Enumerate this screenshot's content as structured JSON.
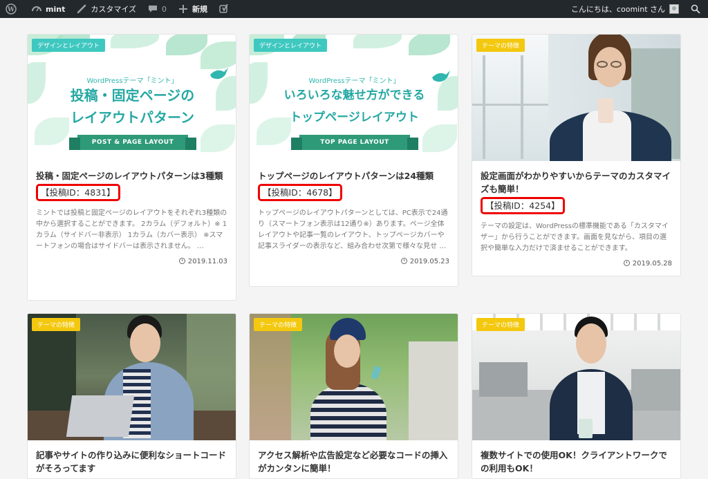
{
  "adminbar": {
    "site_name": "mint",
    "customize": "カスタマイズ",
    "comments_count": "0",
    "new_label": "新規",
    "greeting": "こんにちは、coomint さん"
  },
  "cards": [
    {
      "category": "デザインとレイアウト",
      "thumb_line1": "WordPressテーマ「ミント」",
      "thumb_line2": "投稿・固定ページの",
      "thumb_line3": "レイアウトパターン",
      "ribbon": "POST & PAGE LAYOUT",
      "title": "投稿・固定ページのレイアウトパターンは3種類",
      "post_id": "【投稿ID：4831】",
      "excerpt": "ミントでは投稿と固定ページのレイアウトをそれぞれ3種類の中から選択することができます。 2カラム（デフォルト）※ 1カラム（サイドバー非表示） 1カラム（カバー表示） ※スマートフォンの場合はサイドバーは表示されません。 …",
      "date": "2019.11.03"
    },
    {
      "category": "デザインとレイアウト",
      "thumb_line1": "WordPressテーマ「ミント」",
      "thumb_line2": "いろいろな魅せ方ができる",
      "thumb_line3": "トップページレイアウト",
      "ribbon": "TOP PAGE LAYOUT",
      "title": "トップページのレイアウトパターンは24種類",
      "post_id": "【投稿ID：4678】",
      "excerpt": "トップページのレイアウトパターンとしては、PC表示で24通り（スマートフォン表示は12通り※）あります。ページ全体レイアウトや記事一覧のレイアウト、トップページカバーや記事スライダーの表示など、組み合わせ次第で様々な見せ …",
      "date": "2019.05.23"
    },
    {
      "category": "テーマの特徴",
      "title": "設定画面がわかりやすいからテーマのカスタマイズも簡単！",
      "post_id": "【投稿ID：4254】",
      "excerpt": "テーマの設定は、WordPressの標準機能である「カスタマイザー」から行うことができます。画面を見ながら、項目の選択や簡単な入力だけで済ませることができます。",
      "date": "2019.05.28"
    },
    {
      "category": "テーマの特徴",
      "title": "記事やサイトの作り込みに便利なショートコードがそろってます"
    },
    {
      "category": "テーマの特徴",
      "title": "アクセス解析や広告設定など必要なコードの挿入がカンタンに簡単！"
    },
    {
      "category": "テーマの特徴",
      "title": "複数サイトでの使用OK！クライアントワークでの利用もOK！"
    }
  ],
  "colors": {
    "adminbar": "#23282d",
    "teal_badge": "#3fc8c0",
    "yellow_badge": "#f3c80e",
    "highlight": "#e00000"
  }
}
